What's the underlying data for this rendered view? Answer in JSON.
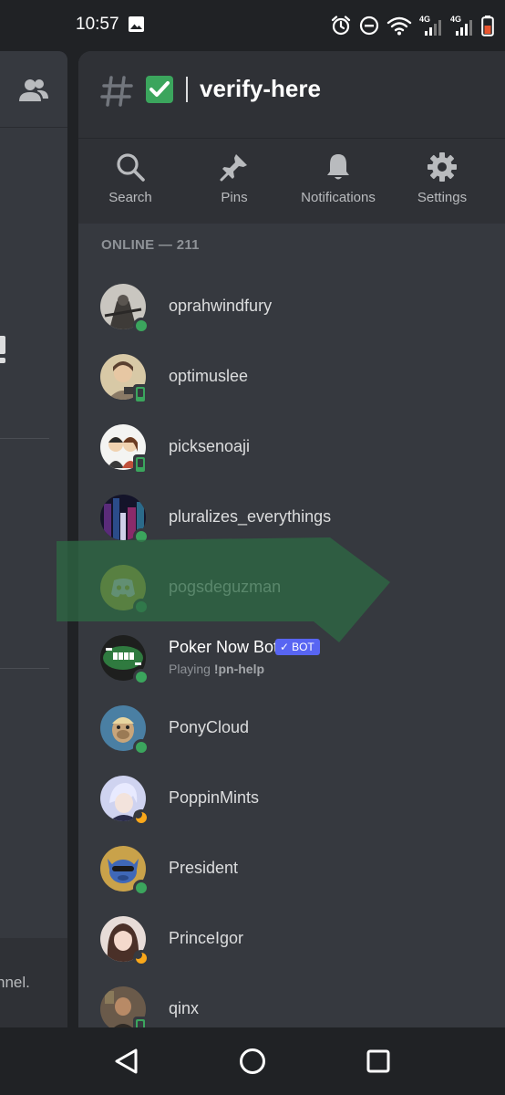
{
  "status_bar": {
    "time": "10:57",
    "icons": [
      "image-icon",
      "alarm-icon",
      "do-not-disturb-icon",
      "wifi-icon",
      "signal-4g-icon",
      "signal-4g-icon",
      "battery-icon"
    ],
    "network_label_1": "4G",
    "network_label_2": "4G"
  },
  "background_panel": {
    "footer_text": "nnel."
  },
  "channel": {
    "name": "verify-here",
    "emoji": "white-check-mark",
    "hash_icon": "hash-icon"
  },
  "toolbar": {
    "search_label": "Search",
    "pins_label": "Pins",
    "notifications_label": "Notifications",
    "settings_label": "Settings"
  },
  "members_section": {
    "title": "ONLINE — 211"
  },
  "members": [
    {
      "name": "oprahwindfury",
      "status": "online",
      "avatar": "avatar-warrior"
    },
    {
      "name": "optimuslee",
      "status": "mobile",
      "avatar": "avatar-person"
    },
    {
      "name": "picksenoaji",
      "status": "mobile",
      "avatar": "avatar-cartoon-couple"
    },
    {
      "name": "pluralizes_everythings",
      "status": "online",
      "avatar": "avatar-neon-city"
    },
    {
      "name": "pogsdeguzman",
      "status": "online",
      "avatar": "avatar-default-discord"
    },
    {
      "name": "Poker Now Bot",
      "status": "online",
      "avatar": "avatar-poker",
      "bot_tag": "BOT",
      "activity_prefix": "Playing ",
      "activity_name": "!pn-help"
    },
    {
      "name": "PonyCloud",
      "status": "online",
      "avatar": "avatar-ape"
    },
    {
      "name": "PoppinMints",
      "status": "idle",
      "avatar": "avatar-anime"
    },
    {
      "name": "President",
      "status": "online",
      "avatar": "avatar-stitch"
    },
    {
      "name": "PrinceIgor",
      "status": "idle",
      "avatar": "avatar-girl"
    },
    {
      "name": "qinx",
      "status": "mobile",
      "avatar": "avatar-gamer"
    }
  ],
  "highlight": {
    "color": "#2d6a44",
    "target": "pogsdeguzman"
  },
  "colors": {
    "accent": "#5865f2",
    "online": "#3ba55d",
    "idle": "#faa81a",
    "panel": "#36393f",
    "header": "#2f3136"
  },
  "navbar": {
    "icons": [
      "back-triangle-icon",
      "home-circle-icon",
      "recents-square-icon"
    ]
  }
}
